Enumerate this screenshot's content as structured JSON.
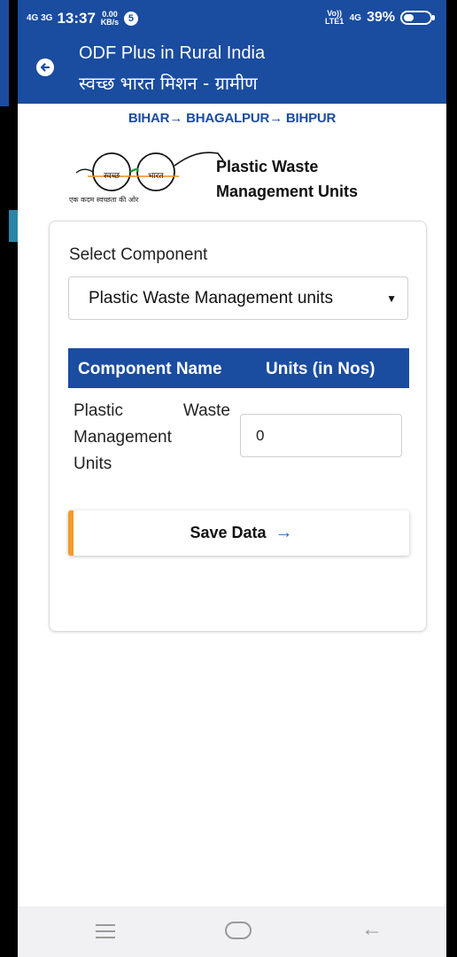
{
  "status_bar": {
    "network_left": "4G 3G",
    "time": "13:37",
    "speed": "0.00 KB/s",
    "notification_count": "5",
    "volte": "Vo)) LTE1",
    "network_right": "4G",
    "battery": "39%"
  },
  "app_bar": {
    "title_en": "ODF Plus in Rural India",
    "title_hi": "स्वच्छ भारत मिशन - ग्रामीण"
  },
  "breadcrumb": "BIHAR→ BHAGALPUR→ BIHPUR",
  "logo": {
    "word1": "स्वच्छ",
    "word2": "भारत",
    "caption": "एक कदम स्वच्छता की ओर"
  },
  "page_heading": {
    "line1": "Plastic Waste",
    "line2": "Management Units"
  },
  "form": {
    "select_label": "Select Component",
    "select_value": "Plastic Waste Management units",
    "caret": "▼"
  },
  "table": {
    "header_name": "Component Name",
    "header_units": "Units (in Nos)",
    "row_name_line1a": "Plastic",
    "row_name_line1b": "Waste",
    "row_name_line2": "Management",
    "row_name_line3": "Units",
    "row_value": "0"
  },
  "save_button": {
    "label": "Save Data",
    "arrow": "→"
  },
  "colors": {
    "primary": "#1a4c9f",
    "accent": "#f49a27",
    "arrow": "#1a6fd6"
  },
  "nav": {
    "back_glyph": "←"
  }
}
